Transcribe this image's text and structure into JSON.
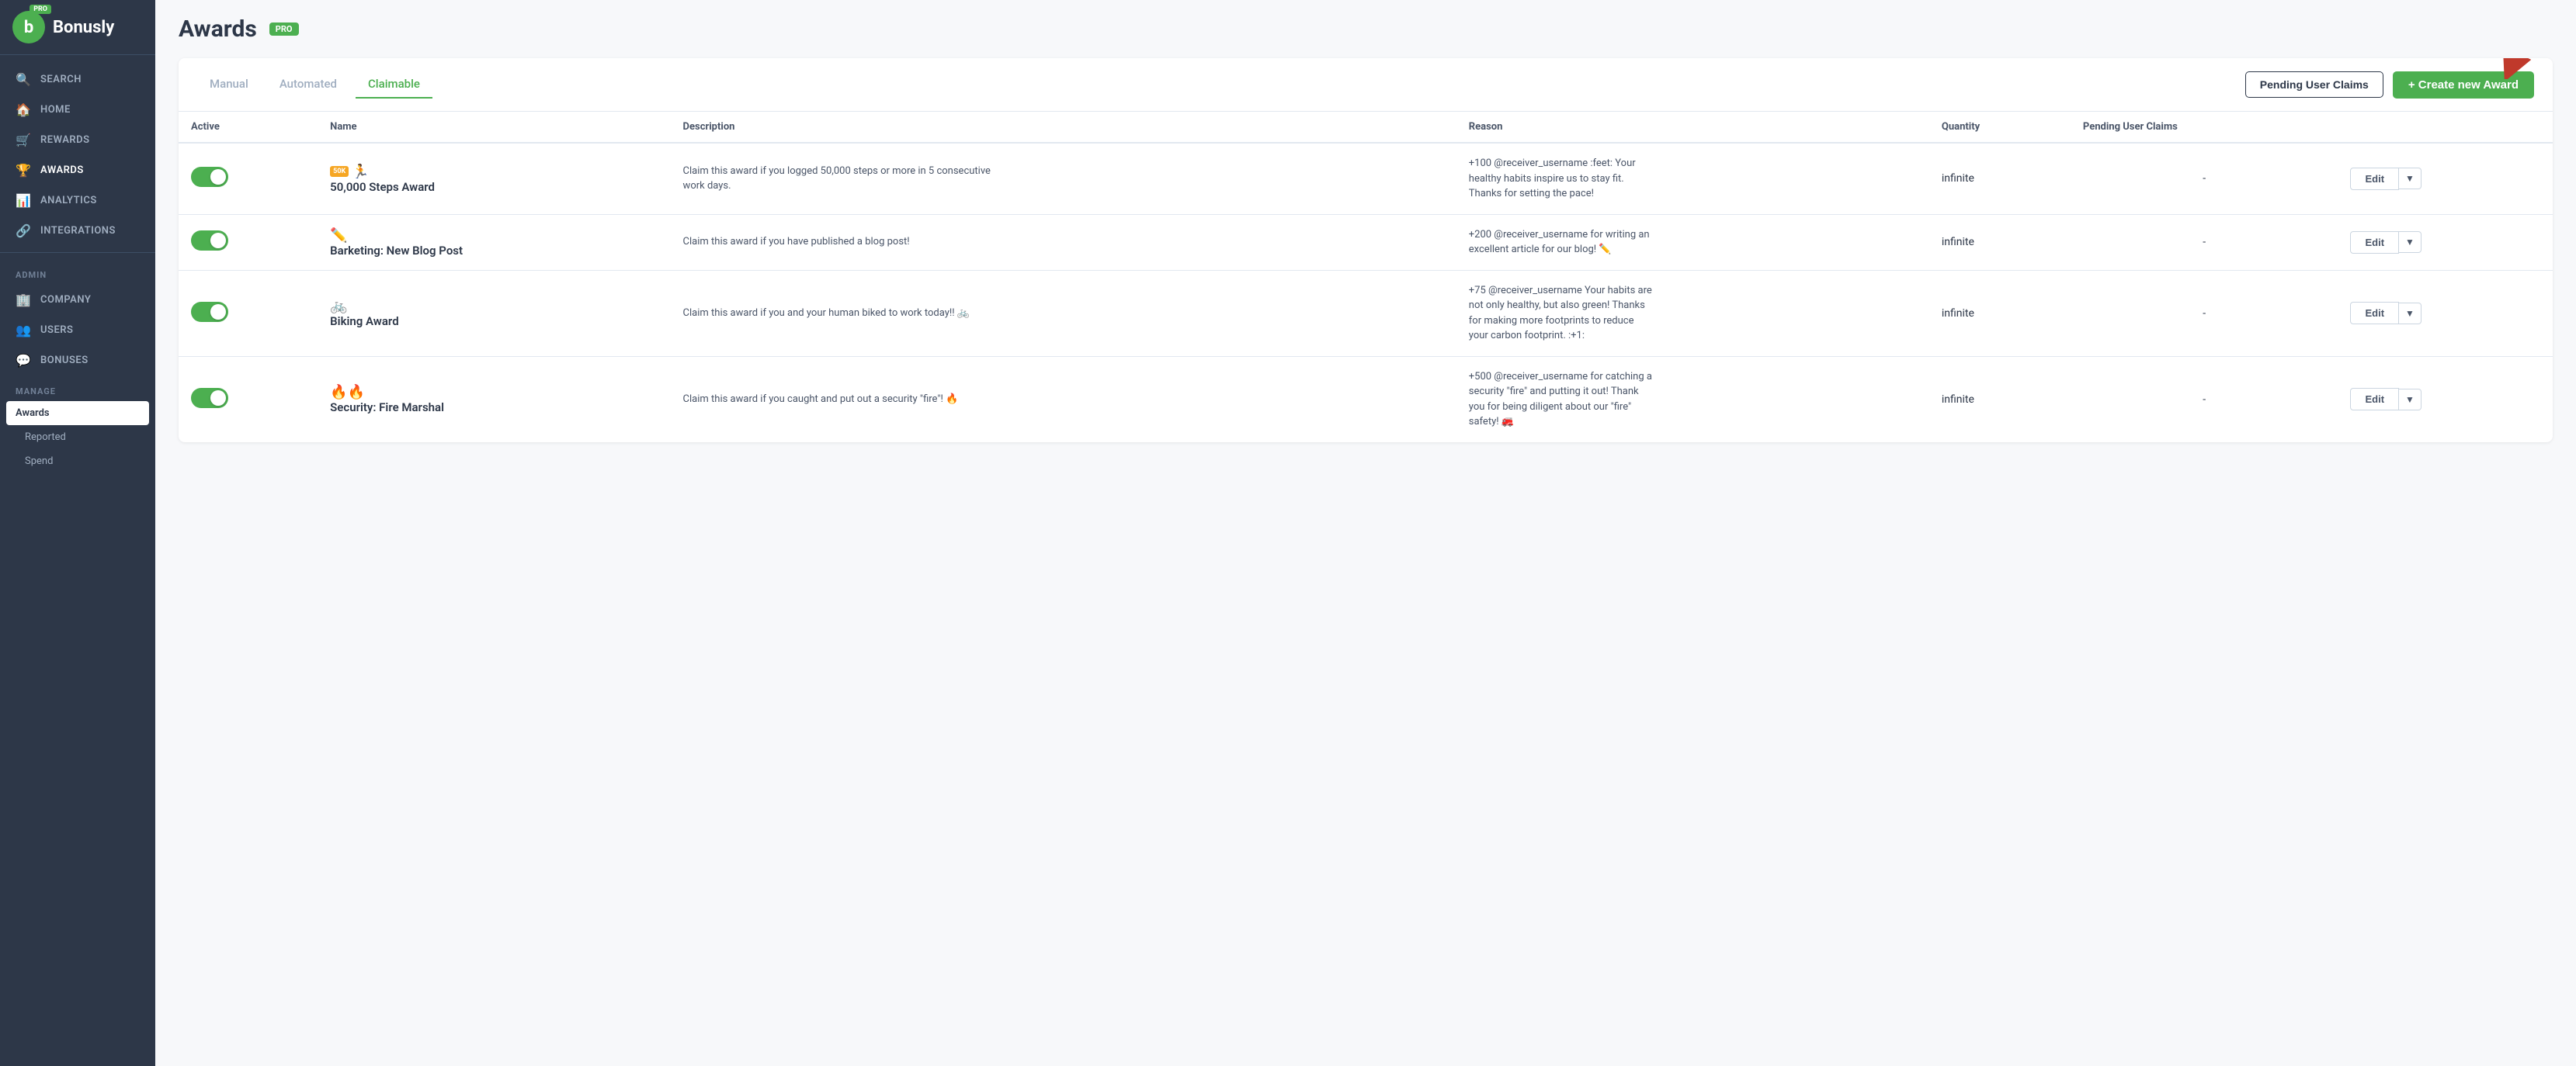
{
  "sidebar": {
    "logo_text": "Bonusly",
    "pro_label": "PRO",
    "nav_items": [
      {
        "id": "search",
        "label": "SEARCH",
        "icon": "🔍"
      },
      {
        "id": "home",
        "label": "HOME",
        "icon": "🏠"
      },
      {
        "id": "rewards",
        "label": "REWARDS",
        "icon": "🛒"
      },
      {
        "id": "awards",
        "label": "AWARDS",
        "icon": "🏆"
      },
      {
        "id": "analytics",
        "label": "ANALYTICS",
        "icon": "📊"
      },
      {
        "id": "integrations",
        "label": "INTEGRATIONS",
        "icon": "🔗"
      }
    ],
    "admin_label": "ADMIN",
    "admin_items": [
      {
        "id": "company",
        "label": "COMPANY",
        "icon": "🏢"
      },
      {
        "id": "users",
        "label": "USERS",
        "icon": "👥"
      },
      {
        "id": "bonuses",
        "label": "BONUSES",
        "icon": "💬"
      }
    ],
    "manage_label": "Manage",
    "sub_items": [
      {
        "id": "awards-sub",
        "label": "Awards",
        "active": true
      },
      {
        "id": "reported",
        "label": "Reported"
      },
      {
        "id": "spend",
        "label": "Spend"
      }
    ]
  },
  "header": {
    "title": "Awards",
    "pro_badge": "PRO"
  },
  "tabs": [
    {
      "id": "manual",
      "label": "Manual",
      "active": false
    },
    {
      "id": "automated",
      "label": "Automated",
      "active": false
    },
    {
      "id": "claimable",
      "label": "Claimable",
      "active": true
    }
  ],
  "toolbar": {
    "pending_btn": "Pending User Claims",
    "create_btn": "+ Create new Award"
  },
  "table": {
    "columns": [
      "Active",
      "Name",
      "Description",
      "Reason",
      "Quantity",
      "Pending User Claims"
    ],
    "rows": [
      {
        "active": true,
        "icon": "🏃",
        "icon_badge": "50K",
        "name": "50,000 Steps Award",
        "description": "Claim this award if you logged 50,000 steps or more in 5 consecutive work days.",
        "reason": "+100 @receiver_username :feet: Your healthy habits inspire us to stay fit. Thanks for setting the pace!",
        "quantity": "infinite",
        "pending": "-",
        "edit_label": "Edit"
      },
      {
        "active": true,
        "icon": "✏️",
        "name": "Barketing: New Blog Post",
        "description": "Claim this award if you have published a blog post!",
        "reason": "+200 @receiver_username for writing an excellent article for our blog! ✏️",
        "quantity": "infinite",
        "pending": "-",
        "edit_label": "Edit"
      },
      {
        "active": true,
        "icon": "🚲",
        "name": "Biking Award",
        "description": "Claim this award if you and your human biked to work today!! 🚲",
        "reason": "+75 @receiver_username Your habits are not only healthy, but also green! Thanks for making more footprints to reduce your carbon footprint. :+1:",
        "quantity": "infinite",
        "pending": "-",
        "edit_label": "Edit"
      },
      {
        "active": true,
        "icon": "🔥",
        "icon2": "🔥",
        "name": "Security: Fire Marshal",
        "description": "Claim this award if you caught and put out a security \"fire\"! 🔥",
        "reason": "+500 @receiver_username for catching a security \"fire\" and putting it out! Thank you for being diligent about our \"fire\" safety! 🚒",
        "quantity": "infinite",
        "pending": "-",
        "edit_label": "Edit"
      }
    ]
  }
}
